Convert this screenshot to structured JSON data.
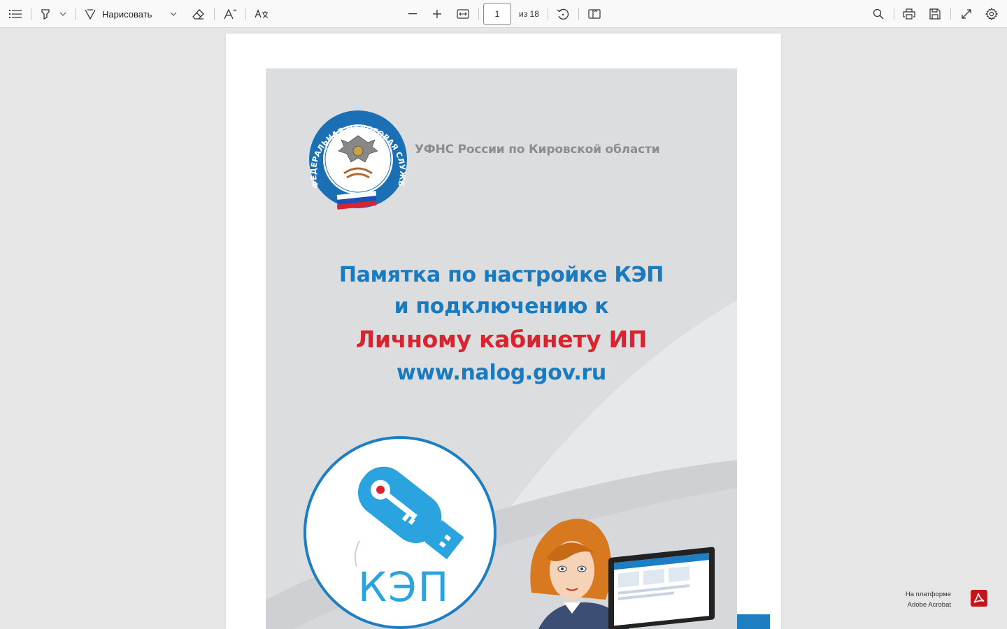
{
  "toolbar": {
    "draw_label": "Нарисовать",
    "page_current": "1",
    "page_total_label": "из 18",
    "icons": [
      "contents-icon",
      "highlight-icon",
      "chevron-down-icon",
      "draw-icon",
      "chevron-down-icon",
      "eraser-icon",
      "read-aloud-icon",
      "translate-icon",
      "zoom-out-icon",
      "zoom-in-icon",
      "fit-width-icon",
      "rotate-icon",
      "page-view-icon",
      "search-icon",
      "print-icon",
      "save-icon",
      "fullscreen-icon",
      "settings-icon"
    ]
  },
  "document": {
    "org_name": "УФНС России по Кировской области",
    "emblem_text": "ФЕДЕРАЛЬНАЯ НАЛОГОВАЯ СЛУЖБА",
    "title_line1": "Памятка по настройке КЭП",
    "title_line2": "и подключению к",
    "title_line3": "Личному кабинету ИП",
    "title_line4": "www.nalog.gov.ru",
    "kep_label": "КЭП"
  },
  "footer": {
    "platform_line1": "На платформе",
    "platform_line2": "Adobe Acrobat"
  },
  "colors": {
    "title_blue": "#1a7abf",
    "title_red": "#d9232e",
    "kep_blue": "#2aa3de",
    "adobe_red": "#c4161c"
  }
}
